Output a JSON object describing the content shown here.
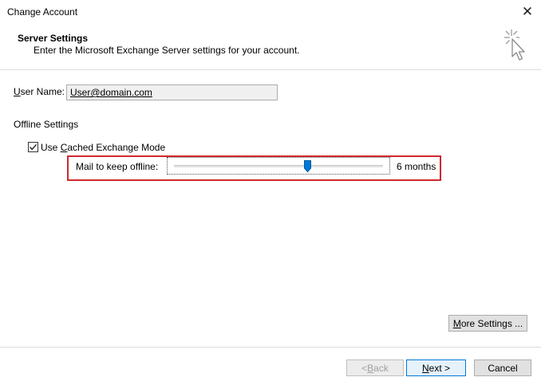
{
  "window": {
    "title": "Change Account",
    "close_glyph": "✕"
  },
  "header": {
    "title": "Server Settings",
    "subtitle": "Enter the Microsoft Exchange Server settings for your account.",
    "icon": "wizard-cursor-icon"
  },
  "user": {
    "label_prefix": "",
    "label_hotkey": "U",
    "label_rest": "ser Name:",
    "value": "User@domain.com"
  },
  "offline": {
    "section_title": "Offline Settings",
    "cached_checked": true,
    "cached_prefix": "Use ",
    "cached_hotkey": "C",
    "cached_rest": "ached Exchange Mode",
    "mail_label": "Mail to keep offline:",
    "slider_value_label": "6 months",
    "slider_fraction": 0.64
  },
  "buttons": {
    "more_hotkey": "M",
    "more_rest": "ore Settings ...",
    "back_prefix": "< ",
    "back_hotkey": "B",
    "back_rest": "ack",
    "next_hotkey": "N",
    "next_rest": "ext >",
    "cancel": "Cancel"
  },
  "colors": {
    "highlight": "#d0282e",
    "accent": "#0078d7",
    "thumb": "#0078d7"
  }
}
